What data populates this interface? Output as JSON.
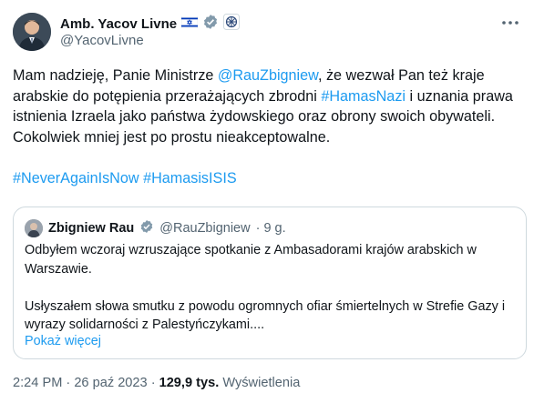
{
  "author": {
    "name": "Amb. Yacov Livne",
    "handle": "@YacovLivne"
  },
  "tweet": {
    "p1_before": "Mam nadzieję, Panie Ministrze ",
    "p1_mention": "@RauZbigniew",
    "p1_mid": ", że wezwał Pan też kraje arabskie do potępienia przerażających zbrodni ",
    "p1_tag": "#HamasNazi",
    "p1_after": " i uznania prawa istnienia Izraela jako państwa żydowskiego oraz obrony swoich obywateli. Cokolwiek mniej jest po prostu nieakceptowalne.",
    "tag1": "#NeverAgainIsNow",
    "tag2": "#HamasisISIS"
  },
  "quote": {
    "name": "Zbigniew Rau",
    "handle": "@RauZbigniew",
    "time": "· 9 g.",
    "text": "Odbyłem wczoraj wzruszające spotkanie z Ambasadorami krajów arabskich w Warszawie.\n\nUsłyszałem słowa smutku z powodu ogromnych ofiar śmiertelnych w Strefie Gazy i wyrazy solidarności z Palestyńczykami....",
    "show_more": "Pokaż więcej"
  },
  "footer": {
    "time": "2:24 PM · 26 paź 2023 ·",
    "views_count": "129,9 tys.",
    "views_label": "Wyświetlenia"
  },
  "colors": {
    "link": "#1d9bf0",
    "verified": "#829aab",
    "muted": "#536471"
  },
  "icons": [
    "israel-flag-icon",
    "verified-badge-icon",
    "affiliate-emblem-icon",
    "more-options-icon"
  ]
}
